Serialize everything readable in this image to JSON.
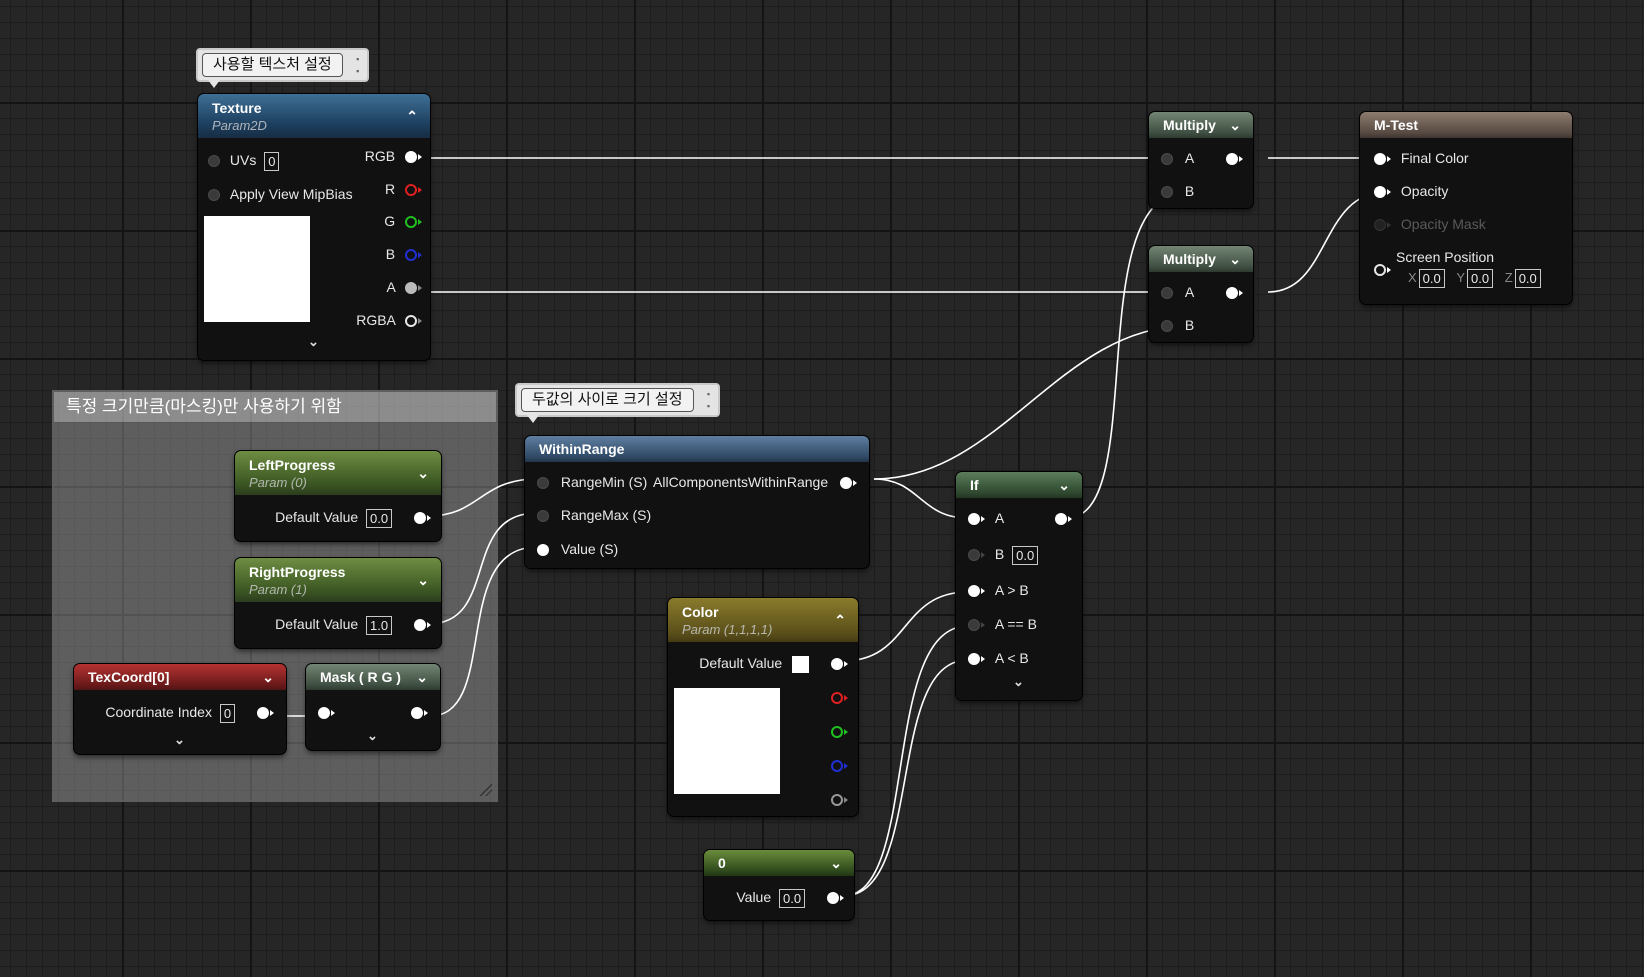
{
  "comments": {
    "texture_note": "사용할 텍스처 설정",
    "range_note": "두값의 사이로 크기 설정",
    "group_title": "특정 크기만큼(마스킹)만 사용하기 위함"
  },
  "nodes": {
    "texture": {
      "title": "Texture",
      "subtitle": "Param2D",
      "uvs_label": "UVs",
      "uvs_value": "0",
      "mipbias_label": "Apply View MipBias",
      "outputs": [
        "RGB",
        "R",
        "G",
        "B",
        "A",
        "RGBA"
      ]
    },
    "multiply1": {
      "title": "Multiply",
      "a": "A",
      "b": "B"
    },
    "multiply2": {
      "title": "Multiply",
      "a": "A",
      "b": "B"
    },
    "result": {
      "title": "M-Test",
      "final_color": "Final Color",
      "opacity": "Opacity",
      "opacity_mask": "Opacity Mask",
      "screen_position": "Screen Position",
      "x_label": "X",
      "x_value": "0.0",
      "y_label": "Y",
      "y_value": "0.0",
      "z_label": "Z",
      "z_value": "0.0"
    },
    "left_progress": {
      "title": "LeftProgress",
      "subtitle": "Param (0)",
      "label": "Default Value",
      "value": "0.0"
    },
    "right_progress": {
      "title": "RightProgress",
      "subtitle": "Param (1)",
      "label": "Default Value",
      "value": "1.0"
    },
    "texcoord": {
      "title": "TexCoord[0]",
      "label": "Coordinate Index",
      "value": "0"
    },
    "mask": {
      "title": "Mask ( R G )"
    },
    "within_range": {
      "title": "WithinRange",
      "range_min": "RangeMin (S)",
      "range_max": "RangeMax (S)",
      "value": "Value (S)",
      "output": "AllComponentsWithinRange"
    },
    "color": {
      "title": "Color",
      "subtitle": "Param (1,1,1,1)",
      "label": "Default Value"
    },
    "if_node": {
      "title": "If",
      "a": "A",
      "b": "B",
      "b_value": "0.0",
      "a_gt_b": "A > B",
      "a_eq_b": "A == B",
      "a_lt_b": "A < B"
    },
    "constant": {
      "title": "0",
      "label": "Value",
      "value": "0.0"
    }
  },
  "colors": {
    "pin_red": "#e02020",
    "pin_green": "#20c020",
    "pin_blue": "#2030d0",
    "wire": "#ffffff",
    "background": "#262626"
  }
}
